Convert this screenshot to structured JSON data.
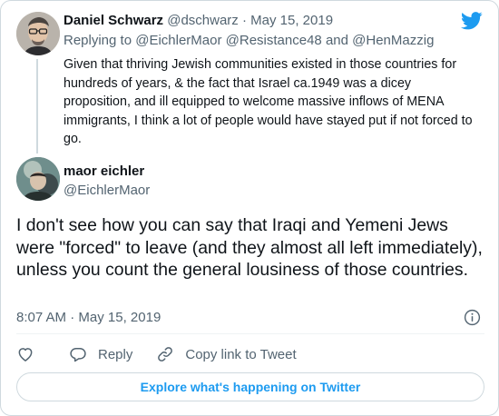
{
  "parent_tweet": {
    "name": "Daniel Schwarz",
    "handle": "@dschwarz",
    "separator": "·",
    "date": "May 15, 2019",
    "replying_prefix": "Replying to",
    "replying_to": [
      "@EichlerMaor",
      "@Resistance48",
      "@HenMazzig"
    ],
    "replying_joiner": "and",
    "text": "Given that thriving Jewish communities existed in those countries for hundreds of years, & the fact that Israel ca.1949 was a dicey proposition, and ill equipped to welcome massive inflows of MENA immigrants, I think a lot of people would have stayed put if not forced to go."
  },
  "main_tweet": {
    "name": "maor eichler",
    "handle": "@EichlerMaor",
    "text": "I don't see how you can say that Iraqi and Yemeni Jews were \"forced\" to leave (and they almost all left immediately), unless you count the general lousiness of those countries.",
    "time": "8:07 AM",
    "separator": "·",
    "date": "May 15, 2019"
  },
  "actions": {
    "reply_label": "Reply",
    "copy_label": "Copy link to Tweet"
  },
  "explore_label": "Explore what's happening on Twitter",
  "icons": {
    "brand": "twitter-bird-icon",
    "info": "info-icon",
    "like": "heart-icon",
    "reply": "speech-bubble-icon",
    "copy": "link-icon"
  },
  "colors": {
    "brand": "#1d9bf0",
    "text": "#0f1419",
    "muted": "#536471",
    "border": "#cfd9de"
  }
}
